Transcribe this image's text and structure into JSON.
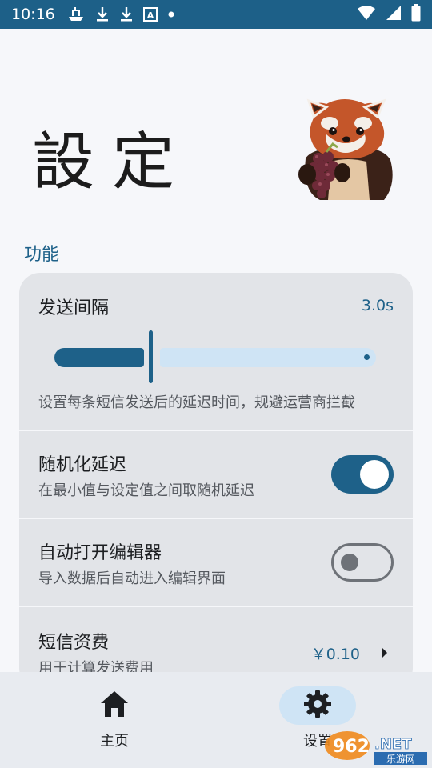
{
  "status_bar": {
    "time": "10:16",
    "left_icons": [
      "ship-icon",
      "download-icon",
      "download-icon",
      "a-box-icon",
      "dot-icon"
    ],
    "right_icons": [
      "wifi-icon",
      "signal-icon",
      "battery-icon"
    ]
  },
  "header": {
    "title": "設定"
  },
  "section": {
    "label": "功能"
  },
  "settings": {
    "send_interval": {
      "title": "发送间隔",
      "value": "3.0s",
      "description": "设置每条短信发送后的延迟时间，规避运营商拦截",
      "slider_fraction": 0.27
    },
    "random_delay": {
      "title": "随机化延迟",
      "description": "在最小值与设定值之间取随机延迟",
      "enabled": true
    },
    "auto_open_editor": {
      "title": "自动打开编辑器",
      "description": "导入数据后自动进入编辑界面",
      "enabled": false
    },
    "sms_fee": {
      "title": "短信资费",
      "description": "用于计算发送费用",
      "value": "￥0.10"
    }
  },
  "bottom_nav": {
    "items": [
      {
        "label": "主页",
        "icon": "home-icon",
        "active": false
      },
      {
        "label": "设置",
        "icon": "gear-icon",
        "active": true
      }
    ]
  },
  "watermark": {
    "text": "962.NET",
    "subtext": "乐游网"
  },
  "colors": {
    "accent": "#1e6189",
    "accent_light": "#cfe4f5",
    "card_bg": "#e2e4e8",
    "page_bg": "#f6f7fa"
  }
}
